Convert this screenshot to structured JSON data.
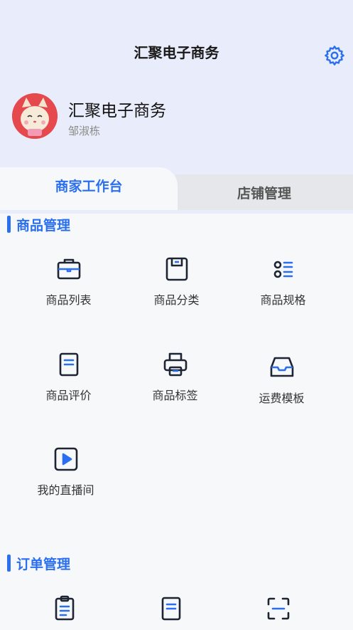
{
  "header": {
    "title": "汇聚电子商务",
    "shop_name": "汇聚电子商务",
    "user_name": "邹淑栋"
  },
  "tabs": [
    {
      "label": "商家工作台",
      "active": true
    },
    {
      "label": "店铺管理",
      "active": false
    }
  ],
  "sections": {
    "goods": {
      "title": "商品管理",
      "items": [
        {
          "label": "商品列表",
          "icon": "briefcase-icon"
        },
        {
          "label": "商品分类",
          "icon": "save-box-icon"
        },
        {
          "label": "商品规格",
          "icon": "list-options-icon"
        },
        {
          "label": "商品评价",
          "icon": "document-icon"
        },
        {
          "label": "商品标签",
          "icon": "printer-icon"
        },
        {
          "label": "运费模板",
          "icon": "inbox-icon"
        },
        {
          "label": "我的直播间",
          "icon": "play-icon"
        }
      ]
    },
    "orders": {
      "title": "订单管理",
      "items": [
        {
          "label": "",
          "icon": "clipboard-icon"
        },
        {
          "label": "",
          "icon": "document-icon"
        },
        {
          "label": "",
          "icon": "scan-icon"
        }
      ]
    }
  },
  "colors": {
    "accent": "#2a6ff0",
    "header_bg": "#e9edfb",
    "icon_dark": "#1d2433"
  }
}
